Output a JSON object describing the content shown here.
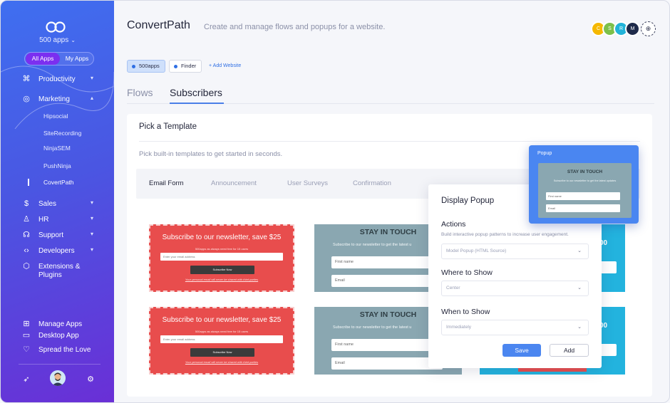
{
  "sidebar": {
    "app_switcher": "500 apps",
    "pill": {
      "all": "All Apps",
      "mine": "My Apps"
    },
    "items": [
      {
        "label": "Productivity",
        "icon": "command-icon"
      },
      {
        "label": "Marketing",
        "icon": "target-icon"
      },
      {
        "label": "Sales",
        "icon": "dollar-icon"
      },
      {
        "label": "HR",
        "icon": "user-icon"
      },
      {
        "label": "Support",
        "icon": "headset-icon"
      },
      {
        "label": "Developers",
        "icon": "code-icon"
      },
      {
        "label": "Extensions &",
        "label2": "Plugins",
        "icon": "cube-icon"
      }
    ],
    "marketing_sub": [
      "Hipsocial",
      "SiteRecording",
      "NinjaSEM",
      "PushNinja",
      "CovertPath"
    ],
    "bottom": [
      {
        "label": "Manage Apps",
        "icon": "grid-icon"
      },
      {
        "label": "Desktop App",
        "icon": "monitor-icon"
      },
      {
        "label": "Spread the Love",
        "icon": "heart-icon"
      }
    ]
  },
  "header": {
    "title": "ConvertPath",
    "subtitle": "Create and manage flows and popups for a website.",
    "avatars": [
      {
        "initial": "C",
        "color": "#f5b800"
      },
      {
        "initial": "S",
        "color": "#7cc04a"
      },
      {
        "initial": "R",
        "color": "#22b3d9"
      },
      {
        "initial": "M",
        "color": "#1e2a4a"
      }
    ]
  },
  "websites": {
    "chips": [
      "500apps",
      "Finder"
    ],
    "add": "+ Add Website"
  },
  "tabs": [
    "Flows",
    "Subscribers"
  ],
  "card": {
    "title": "Pick a Template",
    "subtitle": "Pick built-in templates to get started in seconds.",
    "template_tabs": [
      "Email Form",
      "Announcement",
      "User Surveys",
      "Confirmation"
    ]
  },
  "templates": {
    "red": {
      "heading": "Subscribe to our newsletter, save $25",
      "small": "500apps as always need free for 15 users",
      "input": "Enter your email address",
      "button": "Subscribe Now",
      "note": "Your personal email will never be shared with third parties"
    },
    "gray": {
      "heading": "STAY IN TOUCH",
      "sub": "Subscribe to our newsletter to get the latest u",
      "first_name": "First name",
      "email": "Email"
    },
    "blue": {
      "heading": "00"
    }
  },
  "panel": {
    "title": "Display Popup",
    "actions_label": "Actions",
    "actions_help": "Build interactive popup patterns to increase user engagement.",
    "actions_value": "Model Popup (HTML Source)",
    "where_label": "Where to Show",
    "where_value": "Center",
    "when_label": "When to Show",
    "when_value": "Immediately",
    "save": "Save",
    "add": "Add"
  },
  "preview": {
    "label": "Popup",
    "heading": "STAY IN TOUCH",
    "sub": "Subscribe to our newsletter to get the latest updates",
    "first_name": "First name",
    "email": "Email"
  }
}
